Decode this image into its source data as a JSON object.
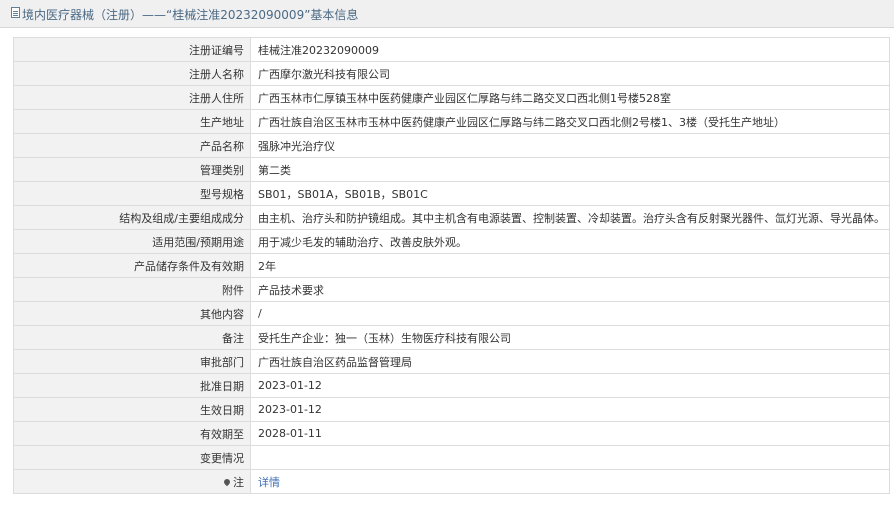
{
  "header": {
    "title": "境内医疗器械（注册）——“桂械注准20232090009”基本信息"
  },
  "rows": [
    {
      "label": "注册证编号",
      "value": "桂械注准20232090009"
    },
    {
      "label": "注册人名称",
      "value": "广西摩尔激光科技有限公司"
    },
    {
      "label": "注册人住所",
      "value": "广西玉林市仁厚镇玉林中医药健康产业园区仁厚路与纬二路交叉口西北侧1号楼528室"
    },
    {
      "label": "生产地址",
      "value": "广西壮族自治区玉林市玉林中医药健康产业园区仁厚路与纬二路交叉口西北侧2号楼1、3楼（受托生产地址）"
    },
    {
      "label": "产品名称",
      "value": "强脉冲光治疗仪"
    },
    {
      "label": "管理类别",
      "value": "第二类"
    },
    {
      "label": "型号规格",
      "value": "SB01，SB01A，SB01B，SB01C"
    },
    {
      "label": "结构及组成/主要组成成分",
      "value": "由主机、治疗头和防护镜组成。其中主机含有电源装置、控制装置、冷却装置。治疗头含有反射聚光器件、氙灯光源、导光晶体。"
    },
    {
      "label": "适用范围/预期用途",
      "value": "用于减少毛发的辅助治疗、改善皮肤外观。"
    },
    {
      "label": "产品储存条件及有效期",
      "value": "2年"
    },
    {
      "label": "附件",
      "value": "产品技术要求"
    },
    {
      "label": "其他内容",
      "value": "/"
    },
    {
      "label": "备注",
      "value": "受托生产企业：独一（玉林）生物医疗科技有限公司"
    },
    {
      "label": "审批部门",
      "value": "广西壮族自治区药品监督管理局"
    },
    {
      "label": "批准日期",
      "value": "2023-01-12"
    },
    {
      "label": "生效日期",
      "value": "2023-01-12"
    },
    {
      "label": "有效期至",
      "value": "2028-01-11"
    },
    {
      "label": "变更情况",
      "value": ""
    }
  ],
  "note_row": {
    "label": "注",
    "link_text": "详情"
  }
}
